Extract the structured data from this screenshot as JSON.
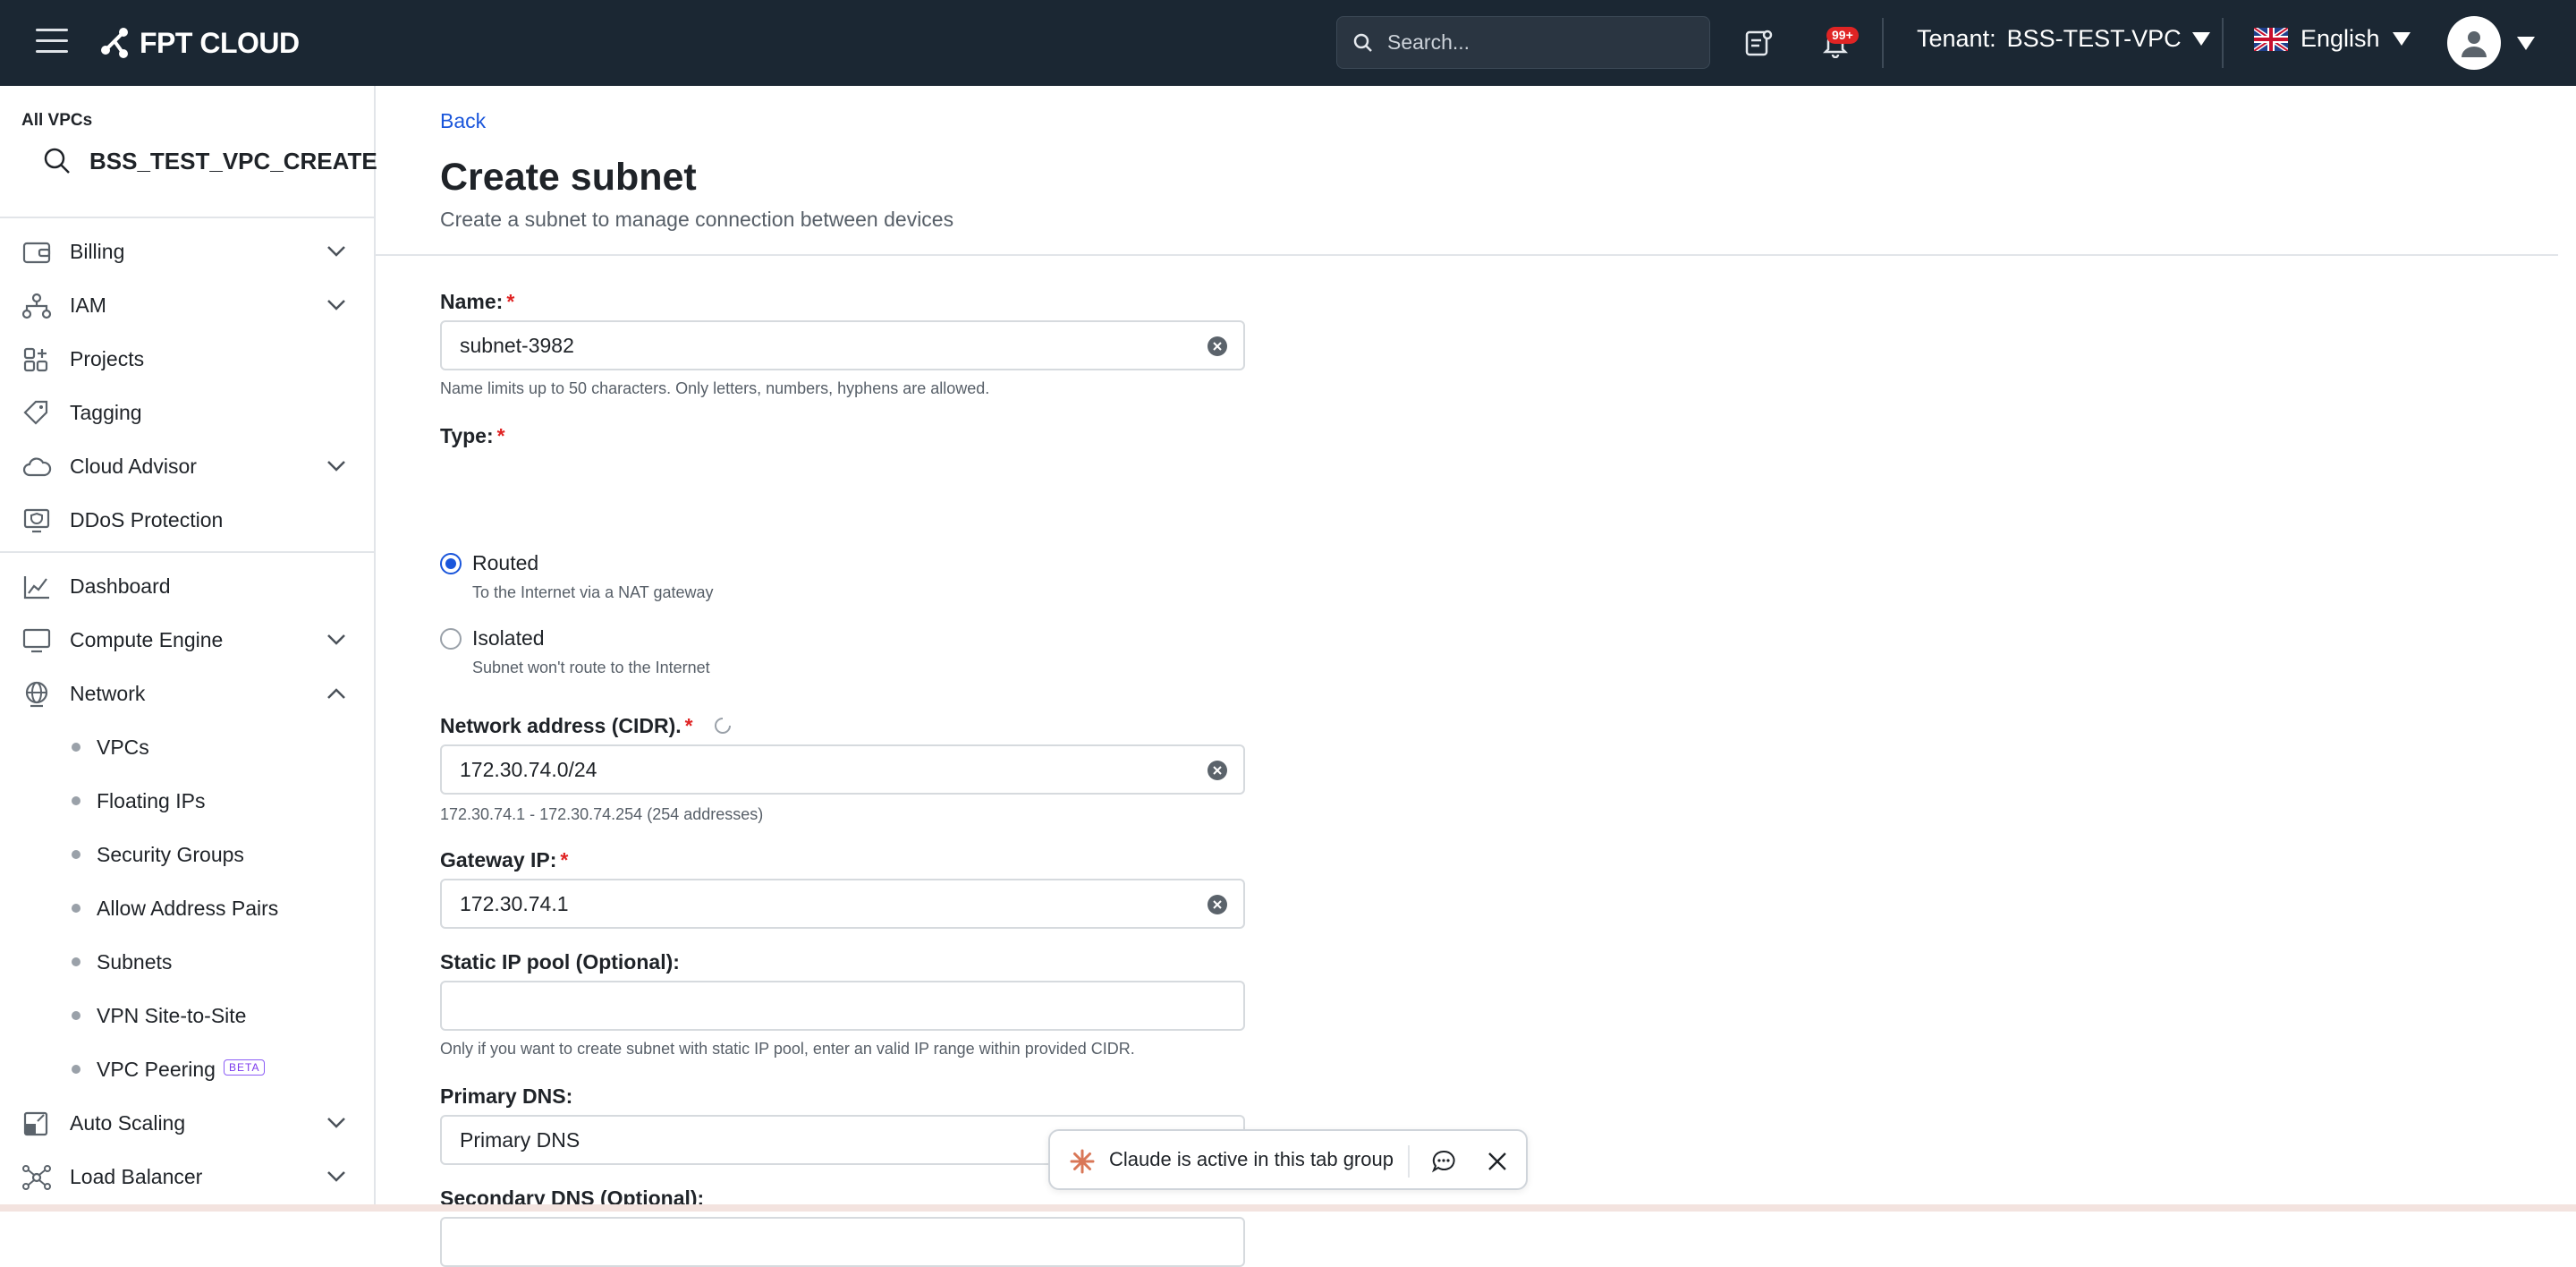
{
  "topbar": {
    "logo_text": "FPT CLOUD",
    "search_placeholder": "Search...",
    "notification_badge": "99+",
    "tenant_label": "Tenant:",
    "tenant_value": "BSS-TEST-VPC",
    "language": "English"
  },
  "sidebar": {
    "all_vpcs_label": "All VPCs",
    "vpc_search_value": "BSS_TEST_VPC_CREATE",
    "items": [
      {
        "label": "Billing",
        "icon": "wallet-icon",
        "expandable": true
      },
      {
        "label": "IAM",
        "icon": "org-chart-icon",
        "expandable": true
      },
      {
        "label": "Projects",
        "icon": "grid-plus-icon",
        "expandable": false
      },
      {
        "label": "Tagging",
        "icon": "tag-icon",
        "expandable": false
      },
      {
        "label": "Cloud Advisor",
        "icon": "cloud-icon",
        "expandable": true
      },
      {
        "label": "DDoS Protection",
        "icon": "shield-monitor-icon",
        "expandable": false
      },
      {
        "label": "Dashboard",
        "icon": "chart-line-icon",
        "expandable": false
      },
      {
        "label": "Compute Engine",
        "icon": "monitor-icon",
        "expandable": true
      },
      {
        "label": "Network",
        "icon": "globe-icon",
        "expandable": true,
        "expanded": true
      },
      {
        "label": "Auto Scaling",
        "icon": "scale-icon",
        "expandable": true
      },
      {
        "label": "Load Balancer",
        "icon": "nodes-icon",
        "expandable": true
      }
    ],
    "network_sub": [
      {
        "label": "VPCs"
      },
      {
        "label": "Floating IPs"
      },
      {
        "label": "Security Groups"
      },
      {
        "label": "Allow Address Pairs"
      },
      {
        "label": "Subnets"
      },
      {
        "label": "VPN Site-to-Site"
      },
      {
        "label": "VPC Peering",
        "badge": "BETA"
      }
    ]
  },
  "main": {
    "back_label": "Back",
    "title": "Create subnet",
    "subtitle": "Create a subnet to manage connection between devices",
    "name": {
      "label": "Name:",
      "value": "subnet-3982",
      "help": "Name limits up to 50 characters. Only letters, numbers, hyphens are allowed."
    },
    "type": {
      "label": "Type:",
      "options": [
        {
          "label": "Routed",
          "description": "To the Internet via a NAT gateway",
          "checked": true
        },
        {
          "label": "Isolated",
          "description": "Subnet won't route to the Internet",
          "checked": false
        }
      ]
    },
    "cidr": {
      "label": "Network address (CIDR).",
      "value": "172.30.74.0/24",
      "help": "172.30.74.1 - 172.30.74.254 (254 addresses)"
    },
    "gateway": {
      "label": "Gateway IP:",
      "value": "172.30.74.1"
    },
    "static_pool": {
      "label": "Static IP pool (Optional):",
      "value": "",
      "help": "Only if you want to create subnet with static IP pool, enter an valid IP range within provided CIDR."
    },
    "primary_dns": {
      "label": "Primary DNS:",
      "placeholder": "Primary DNS"
    },
    "secondary_dns": {
      "label": "Secondary DNS (Optional):",
      "value": ""
    }
  },
  "toast": {
    "text": "Claude is active in this tab group"
  },
  "colors": {
    "topbar_bg": "#1b2733",
    "accent": "#1a56db",
    "required": "#e02424"
  }
}
